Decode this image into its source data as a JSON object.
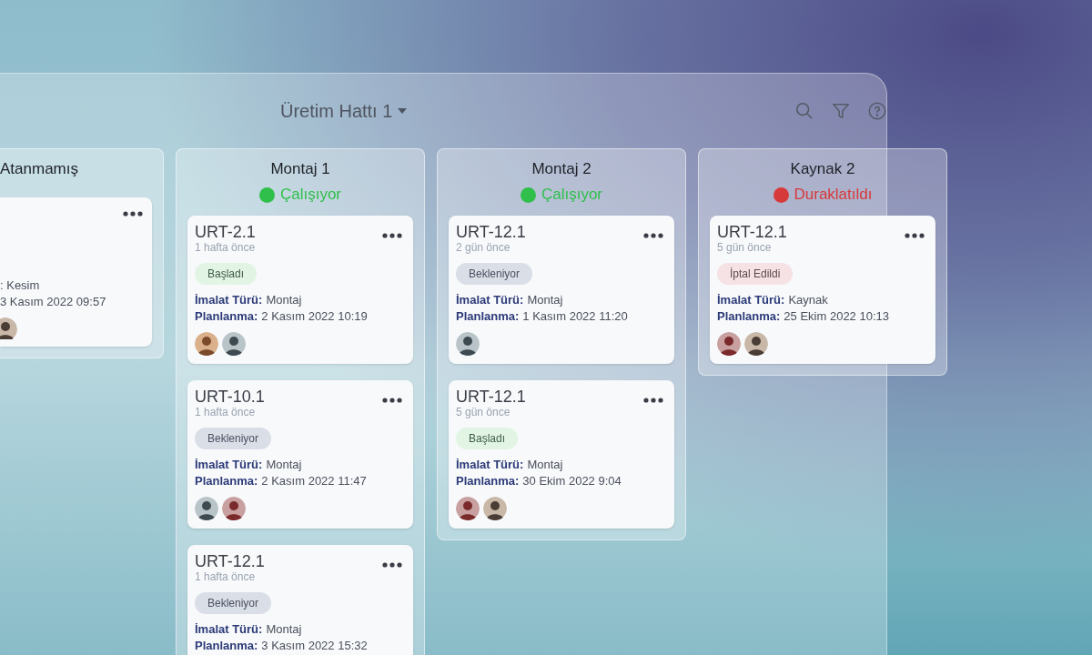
{
  "board": {
    "title": "Üretim Hattı 1"
  },
  "columns": [
    {
      "kind": "partial",
      "name": "Atanmamış",
      "cards": [
        {
          "fields": [
            {
              "value": ": Kesim"
            },
            {
              "value": "3 Kasım 2022 09:57"
            }
          ],
          "avatars": [
            {
              "kind": "picture"
            }
          ]
        }
      ]
    },
    {
      "kind": "full",
      "name": "Montaj 1",
      "status": {
        "label": "Çalışıyor",
        "color": "#2fbf4a"
      },
      "cards": [
        {
          "id": "URT-2.1",
          "time": "1 hafta önce",
          "badge": {
            "label": "Başladı",
            "kind": "started"
          },
          "fields": [
            {
              "label": "İmalat Türü:",
              "value": "Montaj"
            },
            {
              "label": "Planlanma:",
              "value": "2 Kasım 2022 10:19"
            }
          ],
          "avatars": [
            {
              "kind": "picture"
            },
            {
              "kind": "picture"
            }
          ]
        },
        {
          "id": "URT-10.1",
          "time": "1 hafta önce",
          "badge": {
            "label": "Bekleniyor",
            "kind": "waiting"
          },
          "fields": [
            {
              "label": "İmalat Türü:",
              "value": "Montaj"
            },
            {
              "label": "Planlanma:",
              "value": "2 Kasım 2022 11:47"
            }
          ],
          "avatars": [
            {
              "kind": "picture"
            },
            {
              "kind": "picture"
            }
          ]
        },
        {
          "id": "URT-12.1",
          "time": "1 hafta önce",
          "badge": {
            "label": "Bekleniyor",
            "kind": "waiting"
          },
          "fields": [
            {
              "label": "İmalat Türü:",
              "value": "Montaj"
            },
            {
              "label": "Planlanma:",
              "value": "3 Kasım 2022 15:32"
            }
          ]
        }
      ]
    },
    {
      "kind": "full",
      "name": "Montaj 2",
      "status": {
        "label": "Çalışıyor",
        "color": "#2fbf4a"
      },
      "cards": [
        {
          "id": "URT-12.1",
          "time": "2 gün önce",
          "badge": {
            "label": "Bekleniyor",
            "kind": "waiting"
          },
          "fields": [
            {
              "label": "İmalat Türü:",
              "value": "Montaj"
            },
            {
              "label": "Planlanma:",
              "value": "1 Kasım 2022 11:20"
            }
          ],
          "avatars": [
            {
              "kind": "picture"
            }
          ]
        },
        {
          "id": "URT-12.1",
          "time": "5 gün önce",
          "badge": {
            "label": "Başladı",
            "kind": "started"
          },
          "fields": [
            {
              "label": "İmalat Türü:",
              "value": "Montaj"
            },
            {
              "label": "Planlanma:",
              "value": "30 Ekim 2022 9:04"
            }
          ],
          "avatars": [
            {
              "kind": "picture"
            },
            {
              "kind": "picture"
            }
          ]
        }
      ]
    },
    {
      "kind": "full",
      "name": "Kaynak 2",
      "status": {
        "label": "Duraklatıldı",
        "color": "#d63a3a"
      },
      "cards": [
        {
          "id": "URT-12.1",
          "time": "5 gün önce",
          "badge": {
            "label": "İptal Edildi",
            "kind": "cancelled"
          },
          "fields": [
            {
              "label": "İmalat Türü:",
              "value": "Kaynak"
            },
            {
              "label": "Planlanma:",
              "value": "25 Ekim 2022 10:13"
            }
          ],
          "avatars": [
            {
              "kind": "picture"
            },
            {
              "kind": "picture"
            }
          ]
        }
      ]
    }
  ]
}
